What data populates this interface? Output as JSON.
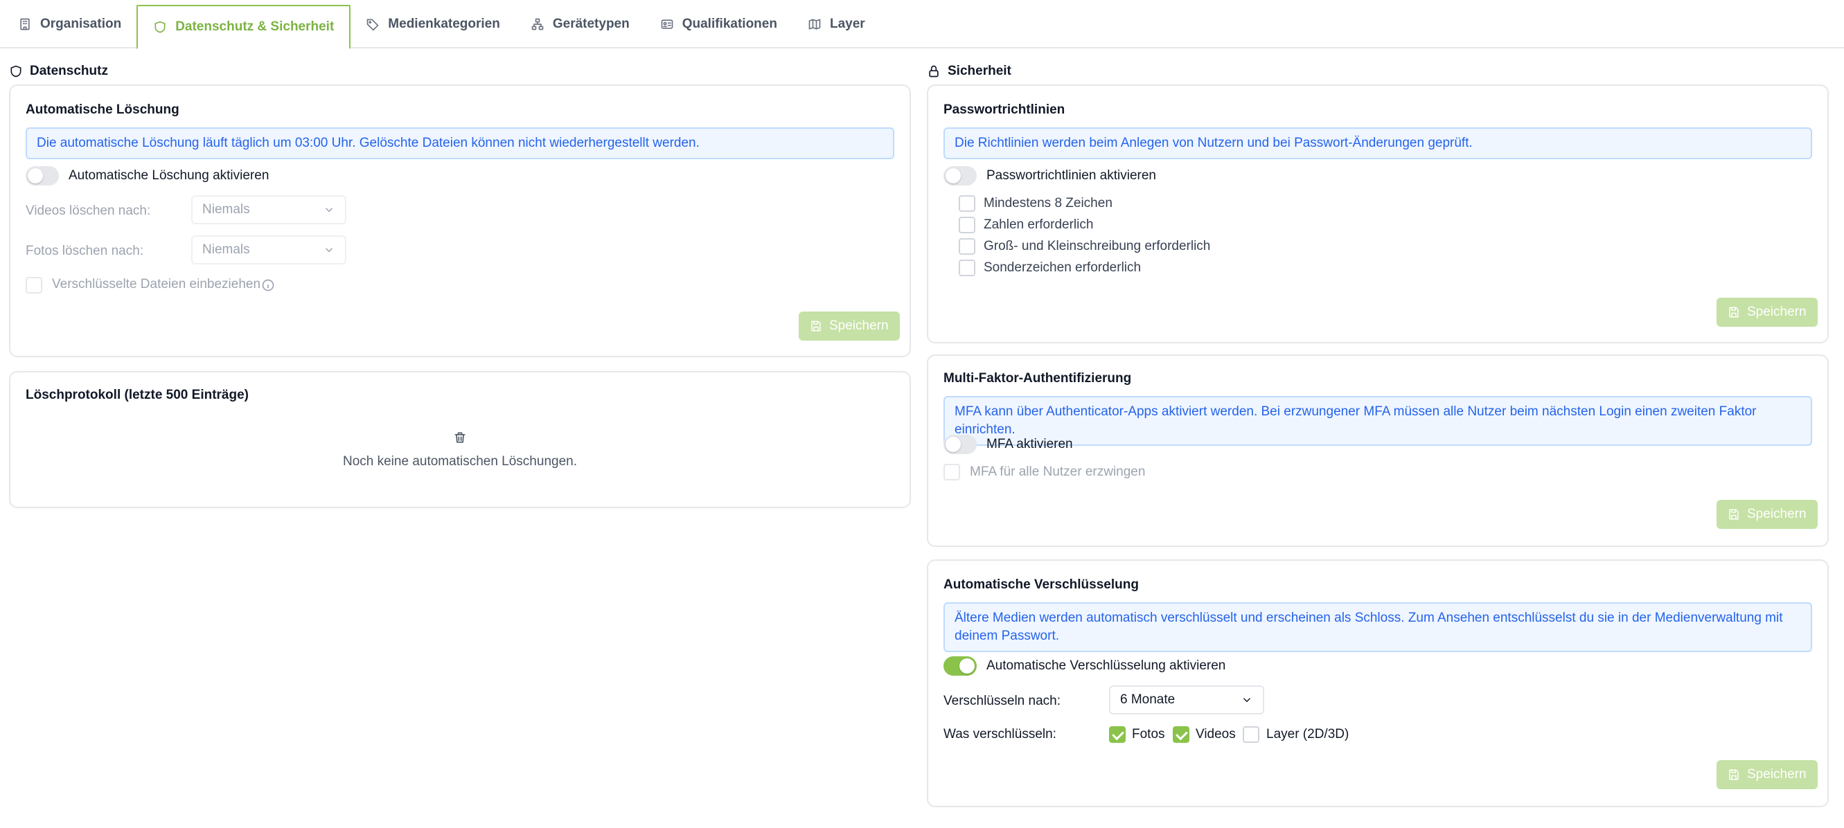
{
  "tabs": [
    {
      "label": "Organisation",
      "icon": "building-icon"
    },
    {
      "label": "Datenschutz & Sicherheit",
      "icon": "shield-icon",
      "active": true
    },
    {
      "label": "Medienkategorien",
      "icon": "tag-icon"
    },
    {
      "label": "Gerätetypen",
      "icon": "network-icon"
    },
    {
      "label": "Qualifikationen",
      "icon": "id-card-icon"
    },
    {
      "label": "Layer",
      "icon": "map-icon"
    }
  ],
  "privacy": {
    "title": "Datenschutz",
    "auto_delete": {
      "title": "Automatische Löschung",
      "info": "Die automatische Löschung läuft täglich um 03:00 Uhr. Gelöschte Dateien können nicht wiederhergestellt werden.",
      "toggle_label": "Automatische Löschung aktivieren",
      "toggle_on": false,
      "videos_label": "Videos löschen nach:",
      "videos_value": "Niemals",
      "photos_label": "Fotos löschen nach:",
      "photos_value": "Niemals",
      "encrypted_label": "Verschlüsselte Dateien einbeziehen",
      "save_label": "Speichern"
    },
    "log": {
      "title": "Löschprotokoll (letzte 500 Einträge)",
      "empty_text": "Noch keine automatischen Löschungen."
    }
  },
  "security": {
    "title": "Sicherheit",
    "password": {
      "title": "Passwortrichtlinien",
      "info": "Die Richtlinien werden beim Anlegen von Nutzern und bei Passwort-Änderungen geprüft.",
      "toggle_label": "Passwortrichtlinien aktivieren",
      "toggle_on": false,
      "rules": [
        "Mindestens 8 Zeichen",
        "Zahlen erforderlich",
        "Groß- und Kleinschreibung erforderlich",
        "Sonderzeichen erforderlich"
      ],
      "save_label": "Speichern"
    },
    "mfa": {
      "title": "Multi-Faktor-Authentifizierung",
      "info": "MFA kann über Authenticator-Apps aktiviert werden. Bei erzwungener MFA müssen alle Nutzer beim nächsten Login einen zweiten Faktor einrichten.",
      "toggle_label": "MFA aktivieren",
      "toggle_on": false,
      "enforce_label": "MFA für alle Nutzer erzwingen",
      "save_label": "Speichern"
    },
    "encryption": {
      "title": "Automatische Verschlüsselung",
      "info": "Ältere Medien werden automatisch verschlüsselt und erscheinen als Schloss. Zum Ansehen entschlüsselst du sie in der Medienverwaltung mit deinem Passwort.",
      "toggle_label": "Automatische Verschlüsselung aktivieren",
      "toggle_on": true,
      "after_label": "Verschlüsseln nach:",
      "after_value": "6 Monate",
      "what_label": "Was verschlüsseln:",
      "options": [
        {
          "label": "Fotos",
          "checked": true
        },
        {
          "label": "Videos",
          "checked": true
        },
        {
          "label": "Layer (2D/3D)",
          "checked": false
        }
      ],
      "save_label": "Speichern"
    }
  },
  "colors": {
    "accent": "#8bc34a",
    "info_text": "#2563eb",
    "info_bg": "#eff6ff"
  }
}
